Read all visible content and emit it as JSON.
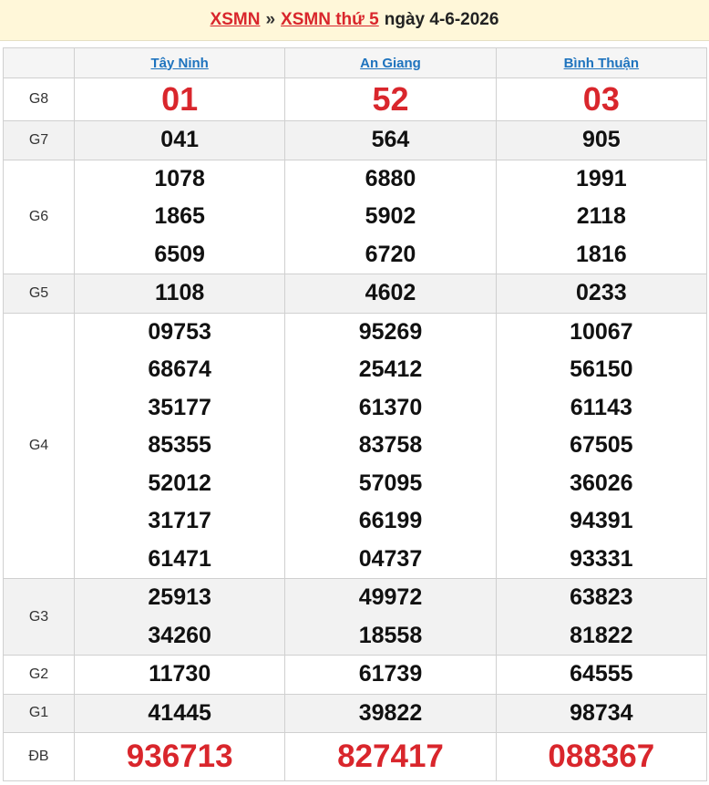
{
  "header": {
    "link1": "XSMN",
    "separator": "»",
    "link2": "XSMN thứ 5",
    "date_text": "ngày 4-6-2026"
  },
  "provinces": [
    "Tây Ninh",
    "An Giang",
    "Bình Thuận"
  ],
  "prizes": [
    {
      "label": "G8",
      "values": [
        [
          "01"
        ],
        [
          "52"
        ],
        [
          "03"
        ]
      ]
    },
    {
      "label": "G7",
      "values": [
        [
          "041"
        ],
        [
          "564"
        ],
        [
          "905"
        ]
      ]
    },
    {
      "label": "G6",
      "values": [
        [
          "1078",
          "1865",
          "6509"
        ],
        [
          "6880",
          "5902",
          "6720"
        ],
        [
          "1991",
          "2118",
          "1816"
        ]
      ]
    },
    {
      "label": "G5",
      "values": [
        [
          "1108"
        ],
        [
          "4602"
        ],
        [
          "0233"
        ]
      ]
    },
    {
      "label": "G4",
      "values": [
        [
          "09753",
          "68674",
          "35177",
          "85355",
          "52012",
          "31717",
          "61471"
        ],
        [
          "95269",
          "25412",
          "61370",
          "83758",
          "57095",
          "66199",
          "04737"
        ],
        [
          "10067",
          "56150",
          "61143",
          "67505",
          "36026",
          "94391",
          "93331"
        ]
      ]
    },
    {
      "label": "G3",
      "values": [
        [
          "25913",
          "34260"
        ],
        [
          "49972",
          "18558"
        ],
        [
          "63823",
          "81822"
        ]
      ]
    },
    {
      "label": "G2",
      "values": [
        [
          "11730"
        ],
        [
          "61739"
        ],
        [
          "64555"
        ]
      ]
    },
    {
      "label": "G1",
      "values": [
        [
          "41445"
        ],
        [
          "39822"
        ],
        [
          "98734"
        ]
      ]
    },
    {
      "label": "ĐB",
      "values": [
        [
          "936713"
        ],
        [
          "827417"
        ],
        [
          "088367"
        ]
      ]
    }
  ],
  "colors": {
    "accent_red": "#d9262c",
    "link_blue": "#1e73be",
    "header_bg": "#fff7d9"
  }
}
